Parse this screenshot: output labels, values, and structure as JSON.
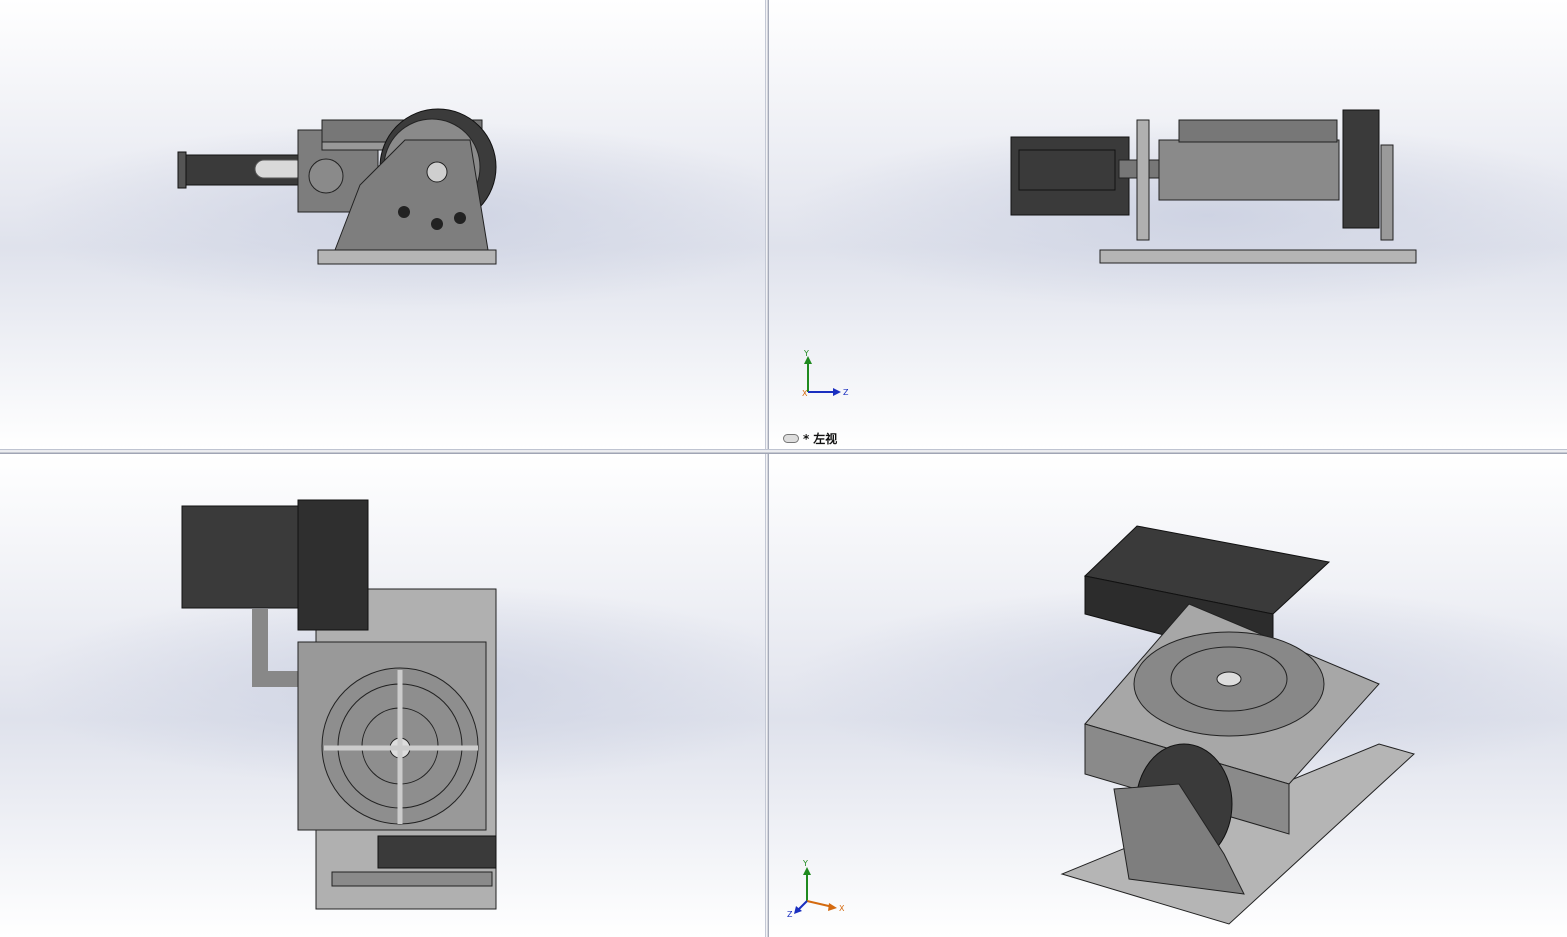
{
  "viewports": {
    "left_view": {
      "label_prefix": "*",
      "label": "左视",
      "triad": {
        "y": "Y",
        "z": "Z",
        "x": "X"
      }
    },
    "isometric": {
      "triad": {
        "y": "Y",
        "z": "Z",
        "x": "X"
      }
    }
  },
  "colors": {
    "part_dark": "#3c3c3c",
    "part_mid": "#7a7a7a",
    "part_light": "#b9b9b9",
    "axis_y": "#1f8a1f",
    "axis_z": "#1a2fc0",
    "axis_x": "#d46a10"
  }
}
